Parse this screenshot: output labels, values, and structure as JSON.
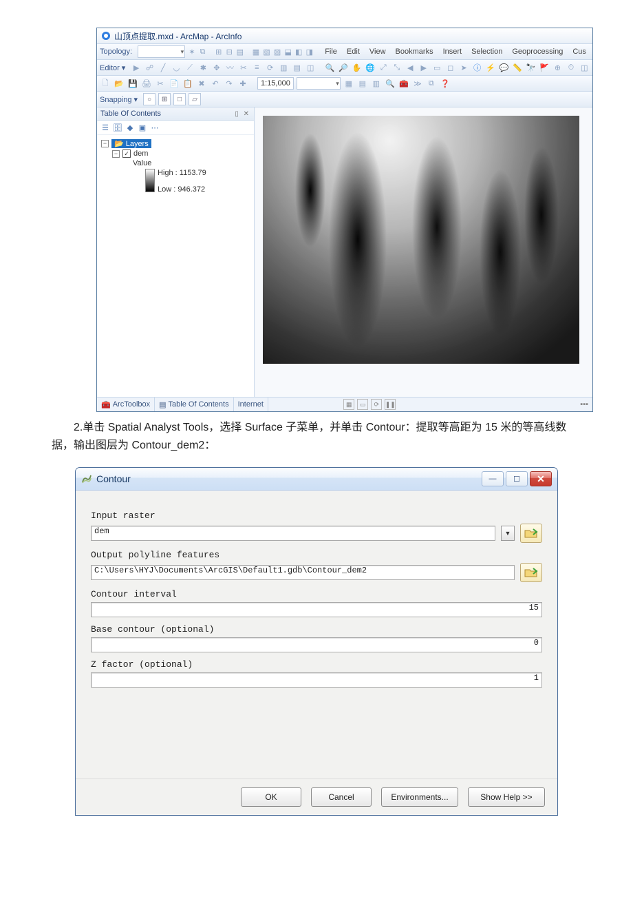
{
  "arcmap": {
    "title": "山顶点提取.mxd - ArcMap - ArcInfo",
    "toolbars": {
      "topology_label": "Topology:",
      "editor_label": "Editor ▾",
      "scale": "1:15,000",
      "snapping_label": "Snapping ▾",
      "menus": [
        "File",
        "Edit",
        "View",
        "Bookmarks",
        "Insert",
        "Selection",
        "Geoprocessing",
        "Cus"
      ]
    },
    "toc": {
      "header": "Table Of Contents",
      "root": "Layers",
      "dem_label": "dem",
      "value_label": "Value",
      "high_label": "High : 1153.79",
      "low_label": "Low : 946.372"
    },
    "tabs": {
      "arctoolbox": "ArcToolbox",
      "toc": "Table Of Contents",
      "internet": "Internet"
    }
  },
  "instruction": {
    "text": "2.单击 Spatial Analyst Tools，选择 Surface 子菜单，并单击 Contour：提取等高距为 15 米的等高线数据，输出图层为 Contour_dem2："
  },
  "dialog": {
    "title": "Contour",
    "labels": {
      "input_raster": "Input raster",
      "output_features": "Output polyline features",
      "contour_interval": "Contour interval",
      "base_contour": "Base contour (optional)",
      "z_factor": "Z factor (optional)"
    },
    "values": {
      "input_raster": "dem",
      "output_features": "C:\\Users\\HYJ\\Documents\\ArcGIS\\Default1.gdb\\Contour_dem2",
      "contour_interval": "15",
      "base_contour": "0",
      "z_factor": "1"
    },
    "buttons": {
      "ok": "OK",
      "cancel": "Cancel",
      "environments": "Environments...",
      "show_help": "Show Help >>"
    }
  }
}
